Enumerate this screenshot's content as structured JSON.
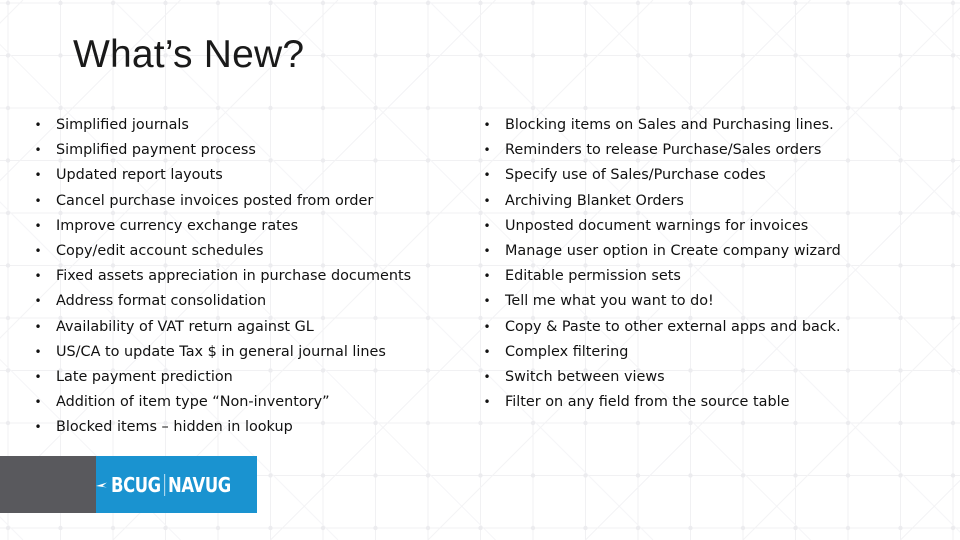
{
  "slide": {
    "title": "What’s New?",
    "left_items": [
      "Simplified journals",
      "Simplified payment process",
      "Updated report layouts",
      "Cancel purchase invoices posted from order",
      "Improve currency exchange rates",
      "Copy/edit account schedules",
      "Fixed assets appreciation in purchase documents",
      "Address format consolidation",
      "Availability of VAT return against GL",
      "US/CA to update Tax $ in general journal lines",
      "Late payment prediction",
      "Addition of item type “Non-inventory”",
      "Blocked items – hidden in lookup"
    ],
    "right_items": [
      "Blocking items on Sales and Purchasing lines.",
      "Reminders to release Purchase/Sales orders",
      "Specify use of Sales/Purchase codes",
      "Archiving Blanket Orders",
      "Unposted document warnings for invoices",
      "Manage user option in Create company wizard",
      "Editable permission sets",
      "Tell me what you want to do!",
      "Copy & Paste to other external apps and back.",
      "Complex filtering",
      "Switch between views",
      "Filter on any field from the source table"
    ],
    "bullet": "•"
  },
  "logo": {
    "left_text": "BCUG",
    "right_text": "NAVUG",
    "icon": "paper-plane-arrow-icon",
    "brand_blue": "#1a93d0",
    "brand_gray": "#59595d"
  }
}
